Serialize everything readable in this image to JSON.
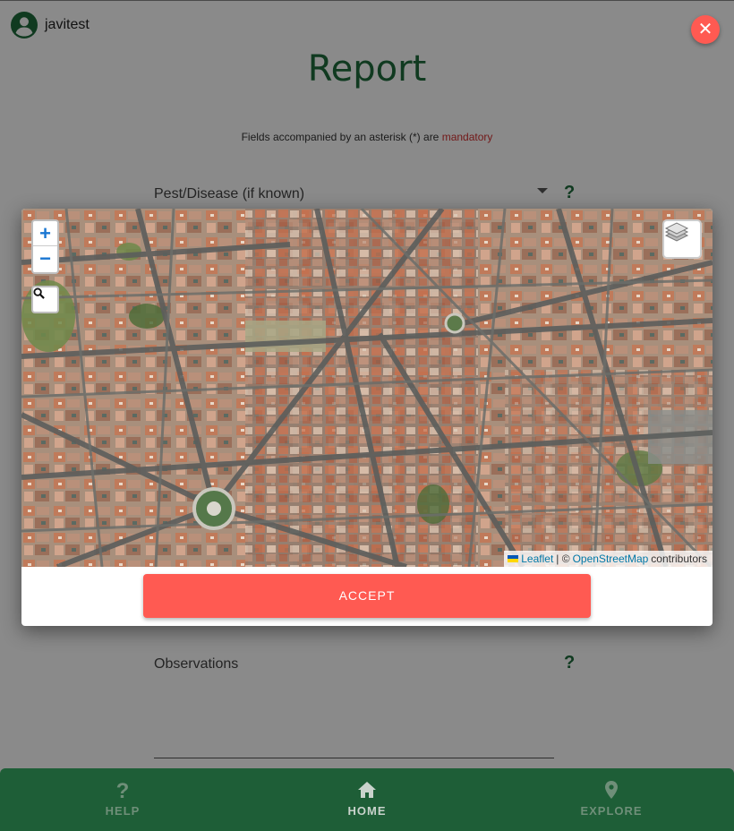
{
  "user": {
    "name": "javitest"
  },
  "title": "Report",
  "mandatory_note": {
    "prefix": "Fields accompanied by an asterisk (*) are ",
    "highlight": "mandatory"
  },
  "form": {
    "pest_label": "Pest/Disease (if known)",
    "observations_label": "Observations",
    "help_glyph": "?"
  },
  "map_modal": {
    "zoom_in": "+",
    "zoom_out": "−",
    "search_icon": "search-icon",
    "layers_icon": "layers-icon",
    "attribution": {
      "leaflet": "Leaflet",
      "separator": "| ©",
      "osm": "OpenStreetMap",
      "suffix": "contributors"
    },
    "accept_label": "ACCEPT"
  },
  "close_glyph": "✕",
  "bottom_nav": {
    "help": "HELP",
    "home": "HOME",
    "explore": "EXPLORE",
    "active": "HOME"
  },
  "colors": {
    "brand_green": "#1e6b3c",
    "nav_green": "#1e5e37",
    "accent_red": "#ff5a52",
    "link_blue": "#0078a8"
  }
}
